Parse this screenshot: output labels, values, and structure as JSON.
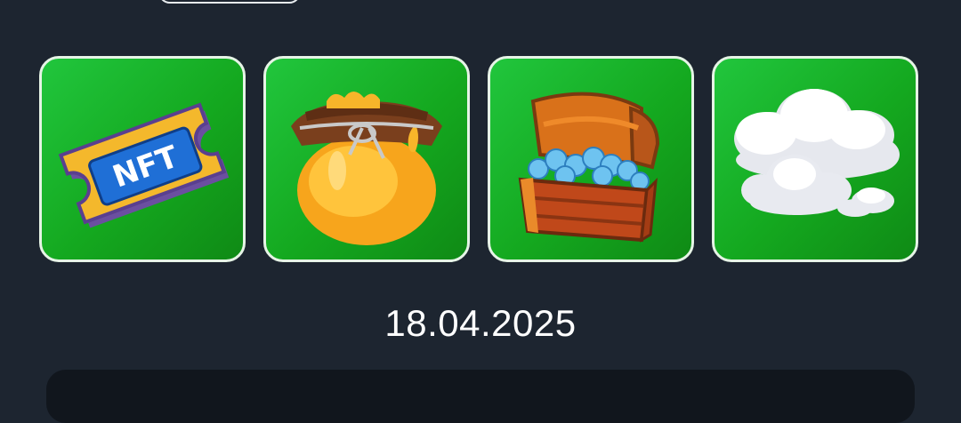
{
  "tiles": [
    {
      "name": "nft-ticket",
      "label": "NFT"
    },
    {
      "name": "honey-jar"
    },
    {
      "name": "treasure-chest"
    },
    {
      "name": "clouds"
    }
  ],
  "date": "18.04.2025",
  "colors": {
    "background": "#1d2530",
    "tile_green": "#1bb82f",
    "tile_border": "#e6f4e6",
    "date_text": "#ffffff"
  }
}
